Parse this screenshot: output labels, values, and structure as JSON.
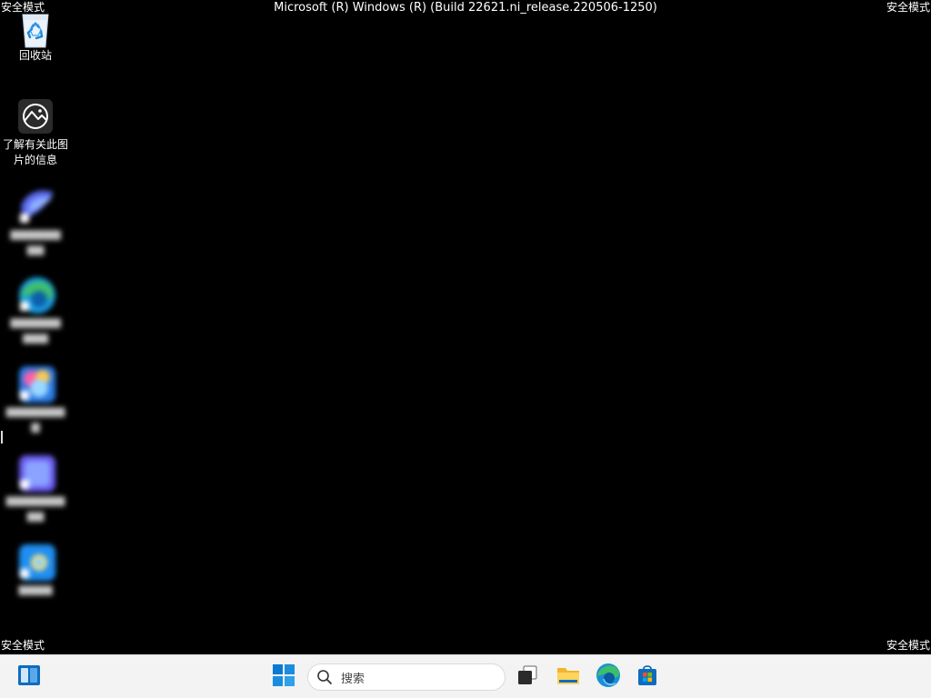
{
  "watermark": {
    "safe_mode": "安全模式",
    "build": "Microsoft (R) Windows (R) (Build 22621.ni_release.220506-1250)"
  },
  "desktop_icons": [
    {
      "label": "回收站",
      "icon": "recycle-bin-icon"
    },
    {
      "label": "了解有关此图片的信息",
      "label_line1": "了解有关此图",
      "label_line2": "片的信息",
      "icon": "learn-about-picture-icon"
    },
    {
      "label": "",
      "icon": "blurred-app-icon"
    },
    {
      "label": "",
      "icon": "edge-icon"
    },
    {
      "label": "",
      "icon": "blurred-app-icon"
    },
    {
      "label": "",
      "icon": "blurred-app-icon"
    },
    {
      "label": "",
      "icon": "blurred-app-icon"
    }
  ],
  "taskbar": {
    "search_placeholder": "搜索",
    "items": [
      "widgets-icon",
      "start-icon",
      "search-icon",
      "task-view-icon",
      "file-explorer-icon",
      "edge-icon",
      "microsoft-store-icon"
    ]
  },
  "colors": {
    "desktop_bg": "#000000",
    "taskbar_bg": "#f3f3f3",
    "start_blue": "#0a78d4"
  }
}
